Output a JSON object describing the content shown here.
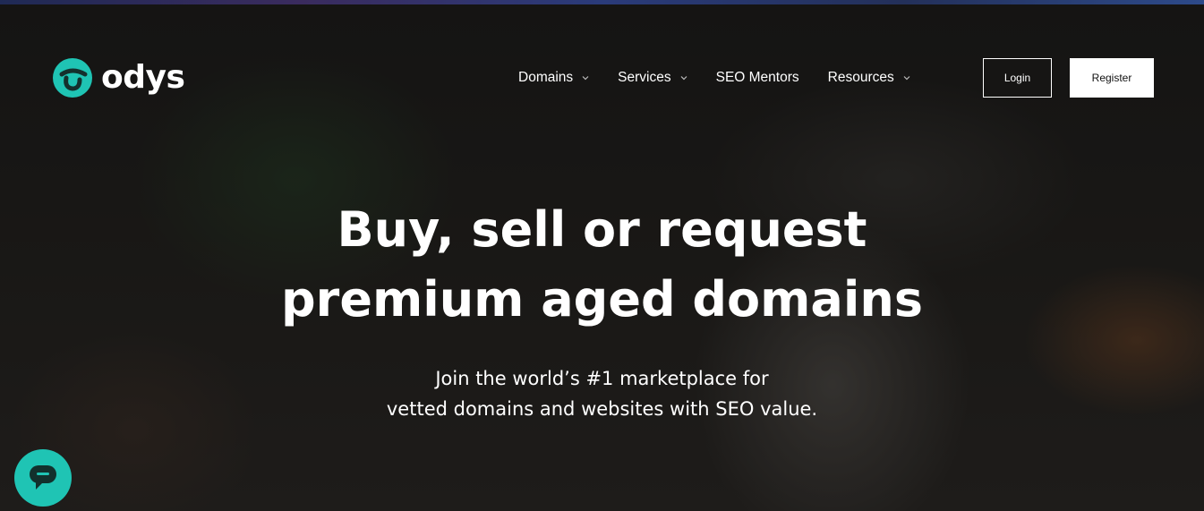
{
  "brand": {
    "name": "odys",
    "accent_color": "#1fc4b4"
  },
  "nav": {
    "items": [
      {
        "label": "Domains",
        "has_dropdown": true
      },
      {
        "label": "Services",
        "has_dropdown": true
      },
      {
        "label": "SEO Mentors",
        "has_dropdown": false
      },
      {
        "label": "Resources",
        "has_dropdown": true
      }
    ]
  },
  "auth": {
    "login_label": "Login",
    "register_label": "Register"
  },
  "hero": {
    "title_line1": "Buy, sell or request",
    "title_line2": "premium aged domains",
    "subtitle_line1": "Join the world’s #1 marketplace for",
    "subtitle_line2": "vetted domains and websites with SEO value."
  },
  "chat_widget": {
    "icon": "chat-bubble-icon",
    "color": "#1fc4b4"
  }
}
